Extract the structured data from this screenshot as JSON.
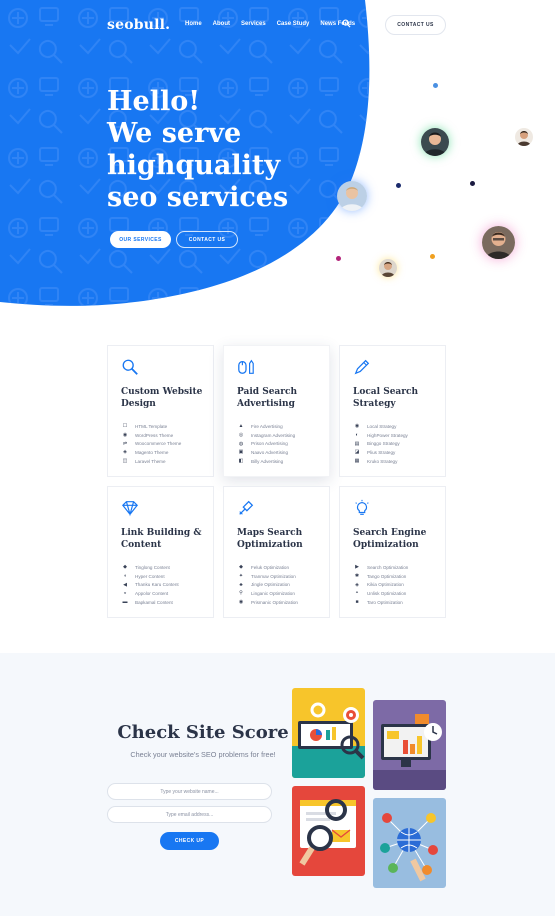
{
  "header": {
    "logo": "seobull.",
    "nav": [
      "Home",
      "About",
      "Services",
      "Case Study",
      "News Feeds"
    ],
    "contact_label": "CONTACT US"
  },
  "hero": {
    "title_lines": [
      "Hello!",
      "We serve",
      "highquality",
      "seo services"
    ],
    "primary_button": "OUR SERVICES",
    "secondary_button": "CONTACT US"
  },
  "services": [
    {
      "title": "Custom Website Design",
      "icon": "magnifier-icon",
      "items": [
        {
          "icon": "☐",
          "label": "HTML Template"
        },
        {
          "icon": "◉",
          "label": "WordPress Theme"
        },
        {
          "icon": "⇌",
          "label": "Woocommerce Theme"
        },
        {
          "icon": "◈",
          "label": "Magento Theme"
        },
        {
          "icon": "◫",
          "label": "Laravel Theme"
        }
      ]
    },
    {
      "title": "Paid Search Advertising",
      "icon": "mouse-pencil-icon",
      "items": [
        {
          "icon": "▲",
          "label": "Fire Advertising"
        },
        {
          "icon": "◎",
          "label": "Instagram Advertising"
        },
        {
          "icon": "◍",
          "label": "Prison Advertising"
        },
        {
          "icon": "▣",
          "label": "Naavo Advertising"
        },
        {
          "icon": "◧",
          "label": "Billy Advertising"
        }
      ]
    },
    {
      "title": "Local Search Strategy",
      "icon": "pen-icon",
      "items": [
        {
          "icon": "◉",
          "label": "Local Strategy"
        },
        {
          "icon": "◐",
          "label": "HighPower Strategy"
        },
        {
          "icon": "▤",
          "label": "Binggo Strategy"
        },
        {
          "icon": "◪",
          "label": "Plius Strategy"
        },
        {
          "icon": "▦",
          "label": "Kruko Strategy"
        }
      ]
    },
    {
      "title": "Link Building & Content",
      "icon": "diamond-icon",
      "items": [
        {
          "icon": "◆",
          "label": "Tinglong Content"
        },
        {
          "icon": "◖",
          "label": "Hyper Content"
        },
        {
          "icon": "◀",
          "label": "Thanku Karu Content"
        },
        {
          "icon": "◒",
          "label": "Appolor Content"
        },
        {
          "icon": "▬",
          "label": "Bapkamal Content"
        }
      ]
    },
    {
      "title": "Maps Search Optimization",
      "icon": "map-pen-icon",
      "items": [
        {
          "icon": "◆",
          "label": "Feluk Optimization"
        },
        {
          "icon": "✦",
          "label": "Tranmav Optimization"
        },
        {
          "icon": "♣",
          "label": "Jingle Optimization"
        },
        {
          "icon": "⚲",
          "label": "Linganic Optimization"
        },
        {
          "icon": "◉",
          "label": "Prismanic Optimization"
        }
      ]
    },
    {
      "title": "Search Engine Optimization",
      "icon": "lightbulb-icon",
      "items": [
        {
          "icon": "▶",
          "label": "Search Optimization"
        },
        {
          "icon": "✱",
          "label": "Tango Optimization"
        },
        {
          "icon": "◈",
          "label": "Kikia Optimization"
        },
        {
          "icon": "◓",
          "label": "Unlisk Optimization"
        },
        {
          "icon": "■",
          "label": "Taro Optimization"
        }
      ]
    }
  ],
  "score": {
    "title": "Check Site Score",
    "subtitle": "Check your website's SEO problems for free!",
    "website_placeholder": "Type your website name...",
    "email_placeholder": "Type email address...",
    "button": "CHECK UP"
  },
  "colors": {
    "primary": "#1877f2",
    "dark": "#2b3448",
    "muted": "#7a8194"
  }
}
